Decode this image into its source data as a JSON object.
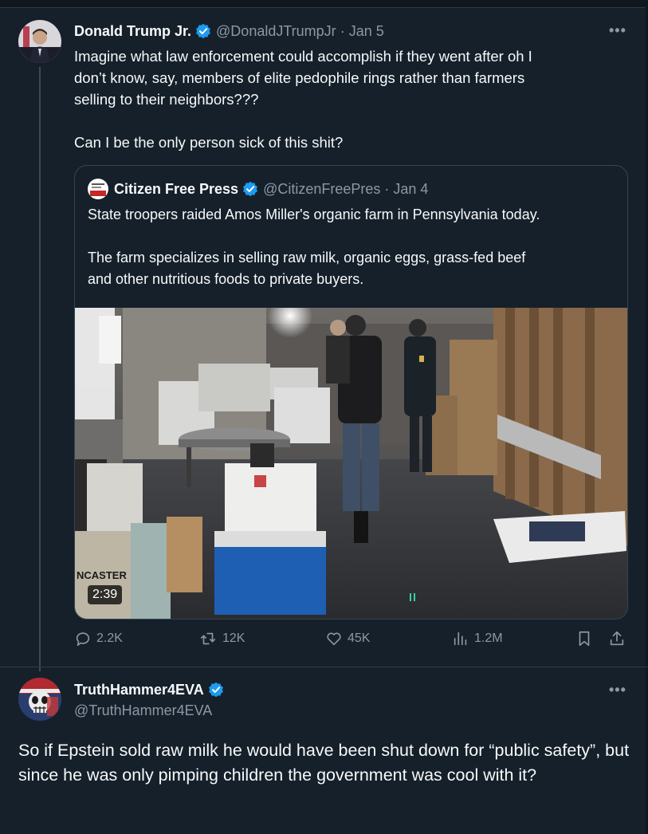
{
  "tweet": {
    "name": "Donald Trump Jr.",
    "handle": "@DonaldJTrumpJr",
    "dot": "·",
    "date": "Jan 5",
    "more": "•••",
    "lines": [
      "Imagine what law enforcement could accomplish if they went after oh I",
      "don’t know, say, members of elite pedophile rings rather than farmers",
      "selling to their neighbors???",
      "Can I be the only person sick of this shit?"
    ],
    "quote": {
      "name": "Citizen Free Press",
      "handle": "@CitizenFreePres",
      "dot": "·",
      "date": "Jan 4",
      "lines": [
        "State troopers raided Amos Miller's organic farm in Pennsylvania today.",
        "The farm specializes in selling raw milk, organic eggs, grass-fed beef",
        "and other nutritious foods to private buyers."
      ],
      "media": {
        "duration": "2:39",
        "sign_text": "NCASTER"
      }
    },
    "stats": {
      "replies": "2.2K",
      "reposts": "12K",
      "likes": "45K",
      "views": "1.2M"
    }
  },
  "reply": {
    "name": "TruthHammer4EVA",
    "handle": "@TruthHammer4EVA",
    "more": "•••",
    "text": "So if Epstein sold raw milk he would have been shut down for “public safety”, but since he was only pimping children the government was cool with it?"
  },
  "colors": {
    "background": "#15202b",
    "text": "#f7f9f9",
    "muted": "#8b98a5",
    "verified": "#1d9bf0",
    "border": "#38444d"
  }
}
